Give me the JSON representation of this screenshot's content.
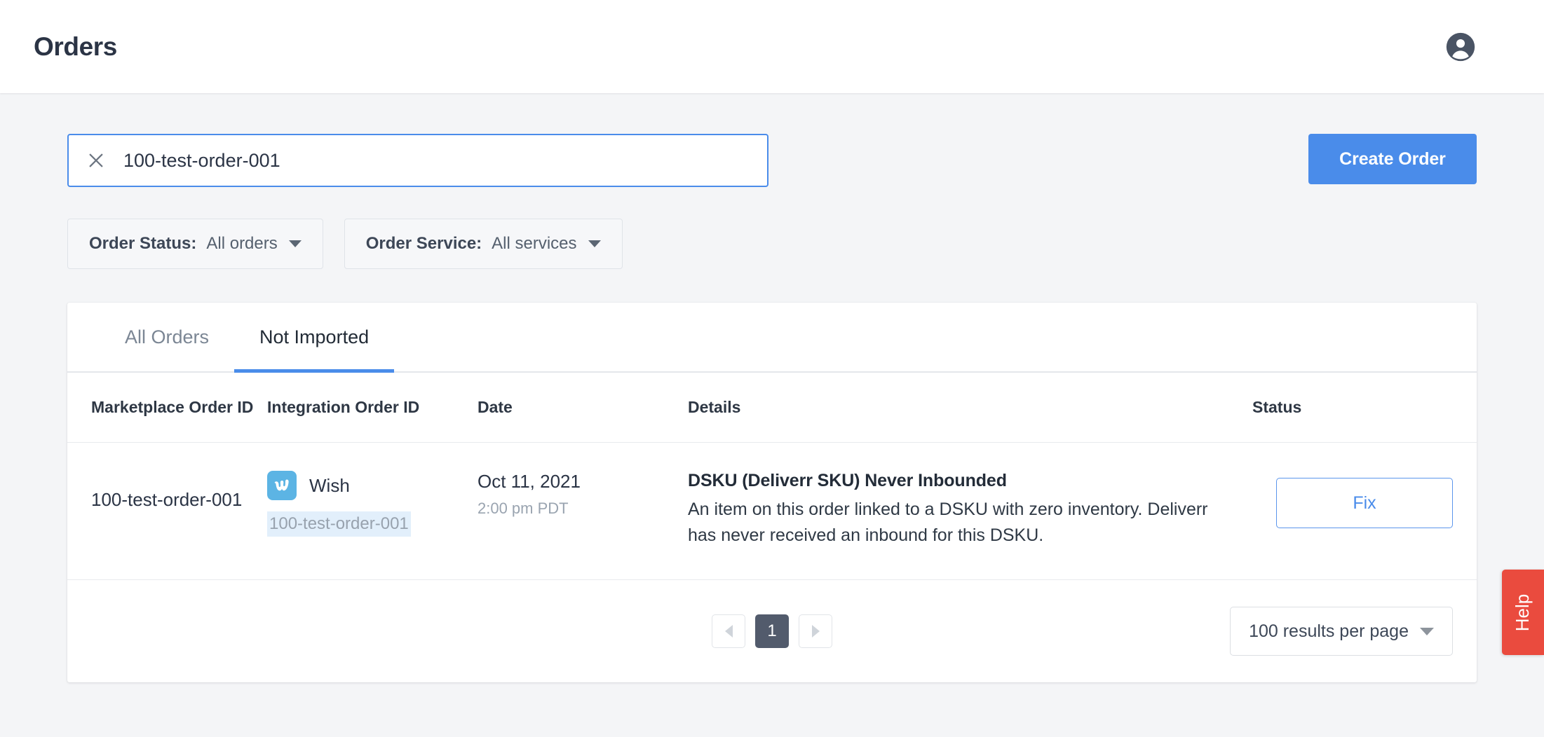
{
  "header": {
    "title": "Orders",
    "avatar_icon": "user-circle-icon"
  },
  "search": {
    "value": "100-test-order-001",
    "placeholder": "Search orders",
    "clear_icon": "close-icon"
  },
  "actions": {
    "create_order_label": "Create Order"
  },
  "filters": [
    {
      "label": "Order Status:",
      "value": "All orders",
      "caret_icon": "chevron-down-icon"
    },
    {
      "label": "Order Service:",
      "value": "All services",
      "caret_icon": "chevron-down-icon"
    }
  ],
  "tabs": [
    {
      "label": "All Orders",
      "active": false
    },
    {
      "label": "Not Imported",
      "active": true
    }
  ],
  "table": {
    "columns": [
      "Marketplace Order ID",
      "Integration Order ID",
      "Date",
      "Details",
      "Status"
    ],
    "rows": [
      {
        "marketplace_order_id": "100-test-order-001",
        "integration": {
          "logo_icon": "wish-logo-icon",
          "name": "Wish",
          "order_id": "100-test-order-001"
        },
        "date": "Oct 11, 2021",
        "time": "2:00 pm PDT",
        "details_title": "DSKU (Deliverr SKU) Never Inbounded",
        "details_body": "An item on this order linked to a DSKU with zero inventory. Deliverr has never received an inbound for this DSKU.",
        "status_action": "Fix"
      }
    ]
  },
  "pagination": {
    "prev_icon": "chevron-left-icon",
    "next_icon": "chevron-right-icon",
    "current_page": "1",
    "per_page": "100 results per page",
    "per_page_caret_icon": "chevron-down-icon"
  },
  "help": {
    "label": "Help"
  },
  "colors": {
    "accent_blue": "#4a8cea",
    "page_bg": "#f4f5f7",
    "wish_blue": "#5cb4e4",
    "help_red": "#ea4b3e",
    "pager_active": "#525b6c",
    "highlight_bg": "#e2effb"
  }
}
